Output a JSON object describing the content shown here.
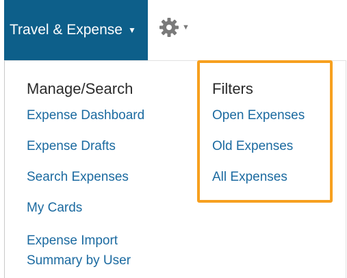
{
  "menubar": {
    "module_label": "Travel & Expense",
    "module_caret": "▼",
    "settings_caret": "▼",
    "settings_icon": "gear-icon"
  },
  "dropdown": {
    "manage": {
      "heading": "Manage/Search",
      "items": [
        "Expense Dashboard",
        "Expense Drafts",
        "Search Expenses",
        "My Cards",
        "Expense Import Summary by User"
      ]
    },
    "filters": {
      "heading": "Filters",
      "items": [
        "Open Expenses",
        "Old Expenses",
        "All Expenses"
      ]
    }
  },
  "colors": {
    "menu_tab_bg": "#0d5f8a",
    "link": "#1b6aa0",
    "highlight": "#f7a01f"
  }
}
